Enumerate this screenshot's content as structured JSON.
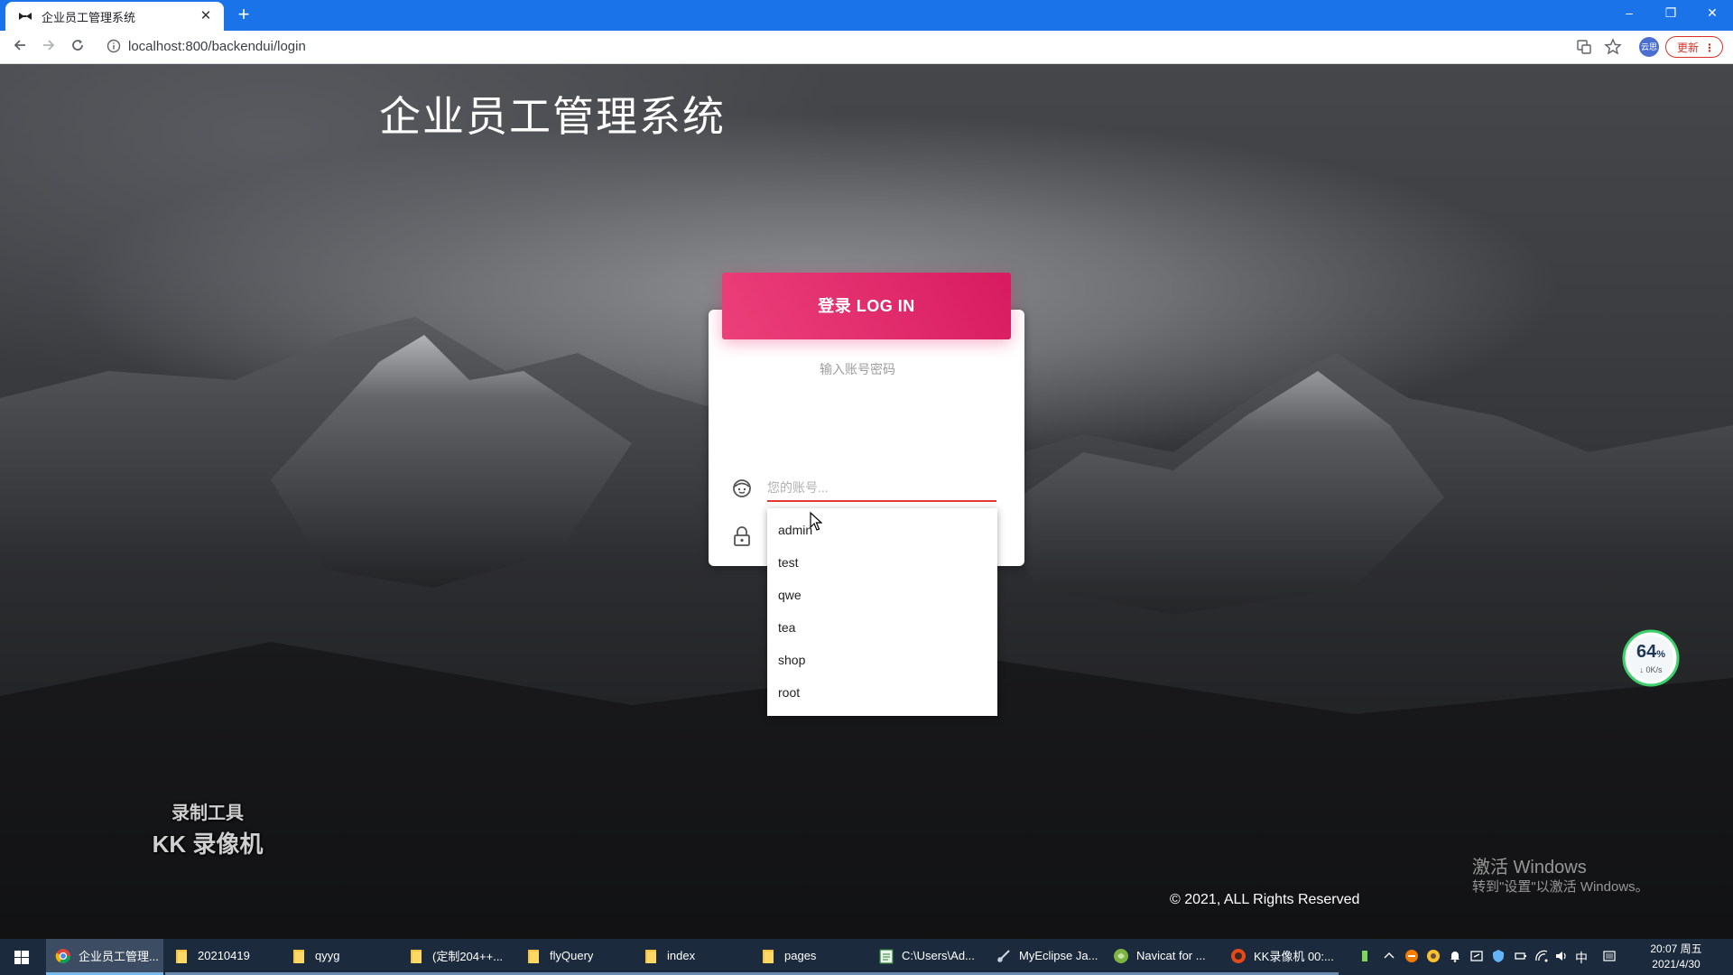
{
  "browser": {
    "tab_title": "企业员工管理系统",
    "new_tab": "+",
    "url": "localhost:800/backendui/login",
    "profile_label": "云思",
    "update_label": "更新",
    "window_minimize": "–",
    "window_restore": "❐",
    "window_close": "✕"
  },
  "page": {
    "system_title": "企业员工管理系统",
    "login_header": "登录 LOG IN",
    "subtitle": "输入账号密码",
    "username_placeholder": "您的账号...",
    "autocomplete_options": [
      "admin",
      "test",
      "qwe",
      "tea",
      "shop",
      "root"
    ],
    "copyright": "© 2021, ALL Rights Reserved",
    "activate_title": "激活 Windows",
    "activate_sub": "转到\"设置\"以激活 Windows。",
    "watermark_line1": "录制工具",
    "watermark_line2": "KK 录像机",
    "gauge_percent": "64",
    "gauge_unit": "%",
    "gauge_speed": "↓ 0K/s"
  },
  "taskbar": {
    "items": [
      {
        "label": "企业员工管理...",
        "icon": "chrome-icon"
      },
      {
        "label": "20210419",
        "icon": "folder-icon"
      },
      {
        "label": "qyyg",
        "icon": "folder-icon"
      },
      {
        "label": "(定制204++...",
        "icon": "folder-icon"
      },
      {
        "label": "flyQuery",
        "icon": "folder-icon"
      },
      {
        "label": "index",
        "icon": "folder-icon"
      },
      {
        "label": "pages",
        "icon": "folder-icon"
      },
      {
        "label": "C:\\Users\\Ad...",
        "icon": "notepad-icon"
      },
      {
        "label": "MyEclipse Ja...",
        "icon": "myeclipse-icon"
      },
      {
        "label": "Navicat for ...",
        "icon": "navicat-icon"
      },
      {
        "label": "KK录像机 00:...",
        "icon": "kk-recorder-icon"
      }
    ],
    "ime": "中",
    "time": "20:07 周五",
    "date": "2021/4/30"
  },
  "colors": {
    "browser_blue": "#1a73e8",
    "login_header_pink": "#e91e63",
    "input_underline_red": "#e53935",
    "taskbar_bg": "#1b2a3d"
  }
}
